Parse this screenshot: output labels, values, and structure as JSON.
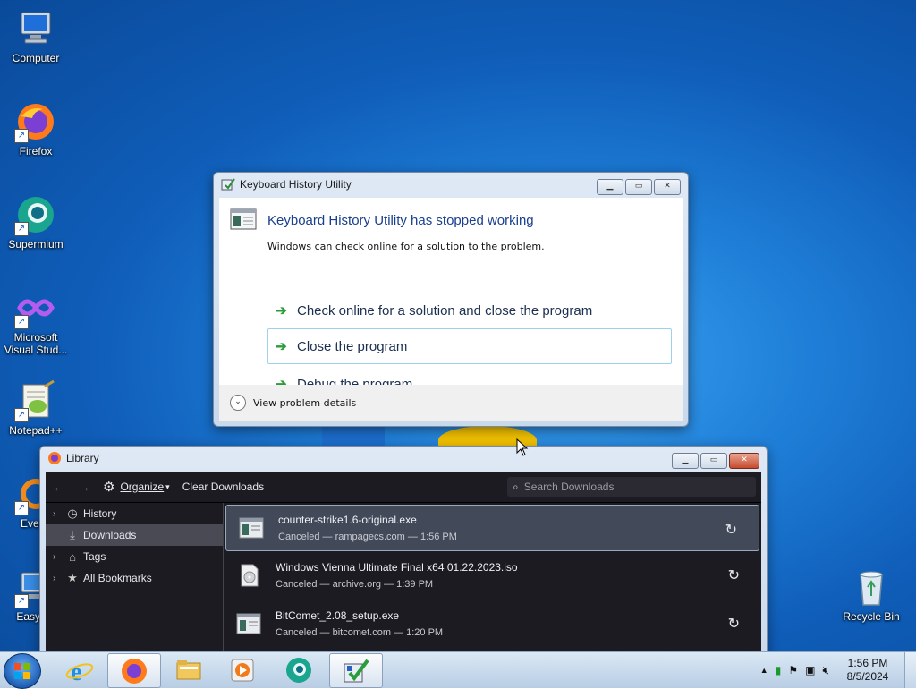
{
  "desktop_icons": [
    {
      "label": "Computer",
      "icon": "computer-icon"
    },
    {
      "label": "Firefox",
      "icon": "firefox-icon"
    },
    {
      "label": "Supermium",
      "icon": "supermium-icon"
    },
    {
      "label": "Microsoft Visual Stud...",
      "icon": "visual-studio-icon"
    },
    {
      "label": "Notepad++",
      "icon": "notepadpp-icon"
    },
    {
      "label": "Everyt",
      "icon": "everything-icon"
    },
    {
      "label": "EasyBC",
      "icon": "easybcd-icon"
    },
    {
      "label": "Recycle Bin",
      "icon": "recycle-bin-icon"
    }
  ],
  "dialog": {
    "window_title": "Keyboard History Utility",
    "heading": "Keyboard History Utility has stopped working",
    "subtext": "Windows can check online for a solution to the problem.",
    "options": [
      "Check online for a solution and close the program",
      "Close the program",
      "Debug the program"
    ],
    "details_label": "View problem details"
  },
  "library": {
    "window_title": "Library",
    "organize_label": "Organize",
    "clear_label": "Clear Downloads",
    "search_placeholder": "Search Downloads",
    "sidebar": [
      {
        "label": "History",
        "icon": "clock-icon"
      },
      {
        "label": "Downloads",
        "icon": "download-icon"
      },
      {
        "label": "Tags",
        "icon": "tag-icon"
      },
      {
        "label": "All Bookmarks",
        "icon": "star-icon"
      }
    ],
    "downloads": [
      {
        "name": "counter-strike1.6-original.exe",
        "status": "Canceled — rampagecs.com — 1:56 PM"
      },
      {
        "name": "Windows Vienna Ultimate Final x64 01.22.2023.iso",
        "status": "Canceled — archive.org — 1:39 PM"
      },
      {
        "name": "BitComet_2.08_setup.exe",
        "status": "Canceled — bitcomet.com — 1:20 PM"
      }
    ]
  },
  "taskbar": {
    "apps": [
      "internet-explorer-icon",
      "firefox-icon",
      "file-explorer-icon",
      "media-player-icon",
      "supermium-icon",
      "error-report-icon"
    ],
    "time": "1:56 PM",
    "date": "8/5/2024"
  },
  "colors": {
    "accent": "#1a3f8f",
    "arrow_green": "#2b9c3a",
    "library_bg": "#1c1b22"
  }
}
